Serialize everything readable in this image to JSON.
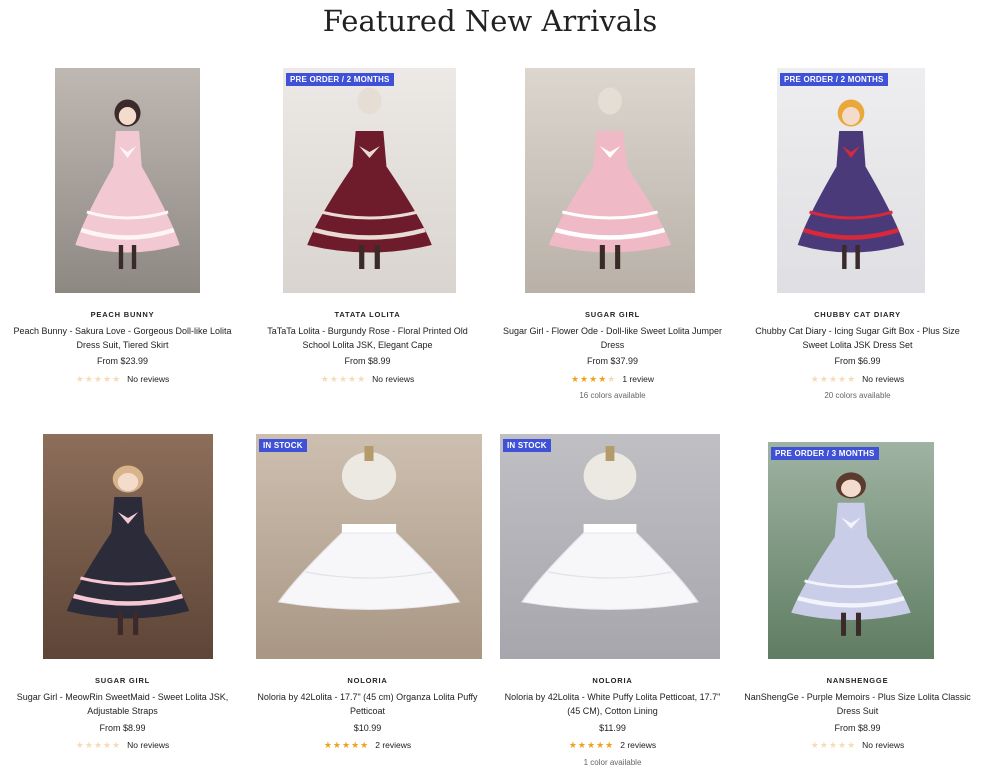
{
  "page": {
    "title": "Featured New Arrivals"
  },
  "products": [
    {
      "brand": "PEACH BUNNY",
      "name": "Peach Bunny - Sakura Love - Gorgeous Doll-like Lolita Dress Suit, Tiered Skirt",
      "price": "From $23.99",
      "stars": 0,
      "reviews": "No reviews",
      "colors": "",
      "badge": "",
      "theme": "pink"
    },
    {
      "brand": "TATATA LOLITA",
      "name": "TaTaTa Lolita - Burgundy Rose - Floral Printed Old School Lolita JSK, Elegant Cape",
      "price": "From $8.99",
      "stars": 0,
      "reviews": "No reviews",
      "colors": "",
      "badge": "PRE ORDER / 2 MONTHS",
      "theme": "burgundy"
    },
    {
      "brand": "SUGAR GIRL",
      "name": "Sugar Girl - Flower Ode - Doll-like Sweet Lolita Jumper Dress",
      "price": "From $37.99",
      "stars": 4,
      "reviews": "1 review",
      "colors": "16 colors available",
      "badge": "",
      "theme": "pinkwhite"
    },
    {
      "brand": "CHUBBY CAT DIARY",
      "name": "Chubby Cat Diary - Icing Sugar Gift Box - Plus Size Sweet Lolita JSK Dress Set",
      "price": "From $6.99",
      "stars": 0,
      "reviews": "No reviews",
      "colors": "20 colors available",
      "badge": "PRE ORDER / 2 MONTHS",
      "theme": "purplered"
    },
    {
      "brand": "SUGAR GIRL",
      "name": "Sugar Girl - MeowRin SweetMaid - Sweet Lolita JSK, Adjustable Straps",
      "price": "From $8.99",
      "stars": 0,
      "reviews": "No reviews",
      "colors": "",
      "badge": "",
      "theme": "maid"
    },
    {
      "brand": "NOLORIA",
      "name": "Noloria by 42Lolita - 17.7\" (45 cm) Organza Lolita Puffy Petticoat",
      "price": "$10.99",
      "stars": 5,
      "reviews": "2 reviews",
      "colors": "",
      "badge": "IN STOCK",
      "theme": "petticoat1"
    },
    {
      "brand": "NOLORIA",
      "name": "Noloria by 42Lolita - White Puffy Lolita Petticoat, 17.7\" (45 CM), Cotton Lining",
      "price": "$11.99",
      "stars": 5,
      "reviews": "2 reviews",
      "colors": "1 color available",
      "badge": "IN STOCK",
      "theme": "petticoat2"
    },
    {
      "brand": "NANSHENGGE",
      "name": "NanShengGe - Purple Memoirs - Plus Size Lolita Classic Dress Suit",
      "price": "From $8.99",
      "stars": 0,
      "reviews": "No reviews",
      "colors": "",
      "badge": "PRE ORDER / 3 MONTHS",
      "theme": "lavender"
    }
  ]
}
